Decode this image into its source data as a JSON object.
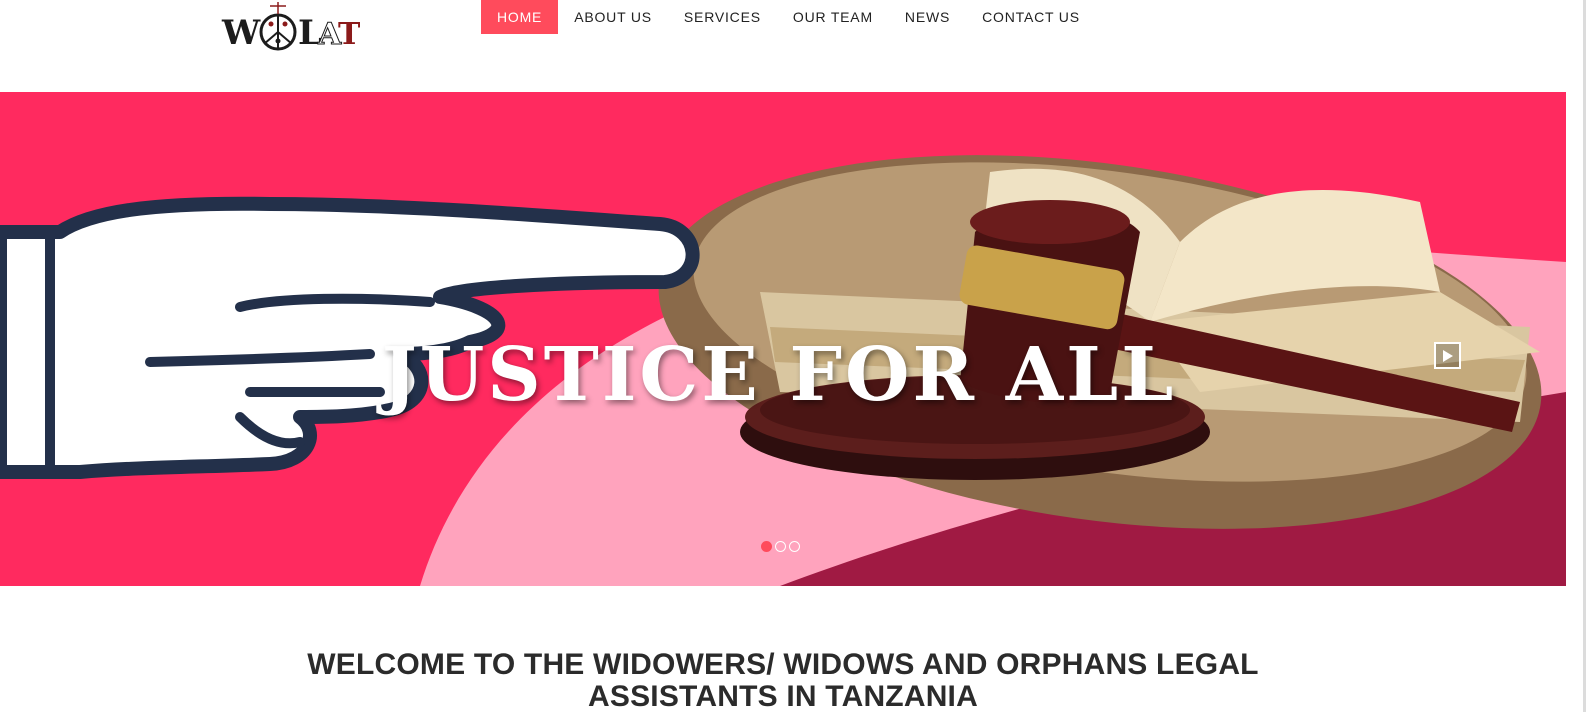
{
  "logo": {
    "text": "WOLAT",
    "colors": {
      "dark": "#1c1c1c",
      "accent": "#8b1a1a"
    }
  },
  "nav": {
    "items": [
      {
        "label": "HOME",
        "active": true
      },
      {
        "label": "ABOUT US",
        "active": false
      },
      {
        "label": "SERVICES",
        "active": false
      },
      {
        "label": "OUR TEAM",
        "active": false
      },
      {
        "label": "NEWS",
        "active": false
      },
      {
        "label": "CONTACT US",
        "active": false
      }
    ],
    "active_color": "#ff4b5c"
  },
  "hero": {
    "title": "JUSTICE FOR ALL",
    "background": "#ff2a5f",
    "play_icon": "play-icon",
    "slides": {
      "count": 3,
      "active_index": 0
    }
  },
  "welcome": {
    "line1": "WELCOME TO THE WIDOWERS/ WIDOWS AND ORPHANS LEGAL",
    "line2": "ASSISTANTS IN TANZANIA"
  }
}
